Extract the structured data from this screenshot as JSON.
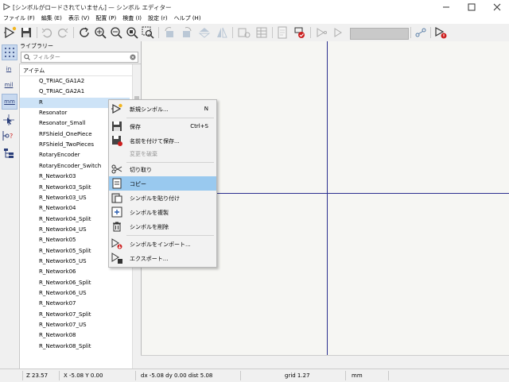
{
  "window": {
    "title": "[シンボルがロードされていません] — シンボル エディター",
    "controls": [
      "minimize",
      "maximize",
      "close"
    ]
  },
  "menubar": [
    "ファイル (F)",
    "編集 (E)",
    "表示 (V)",
    "配置 (P)",
    "検査 (I)",
    "設定 (r)",
    "ヘルプ (H)"
  ],
  "units": {
    "in": "in",
    "mil": "mil",
    "mm": "mm"
  },
  "library": {
    "header": "ライブラリー",
    "filter_placeholder": "フィルター",
    "column": "アイテム",
    "items": [
      "Q_TRIAC_GA1A2",
      "Q_TRIAC_GA2A1",
      "R",
      "Resonator",
      "Resonator_Small",
      "RFShield_OnePiece",
      "RFShield_TwoPieces",
      "RotaryEncoder",
      "RotaryEncoder_Switch",
      "R_Network03",
      "R_Network03_Split",
      "R_Network03_US",
      "R_Network04",
      "R_Network04_Split",
      "R_Network04_US",
      "R_Network05",
      "R_Network05_Split",
      "R_Network05_US",
      "R_Network06",
      "R_Network06_Split",
      "R_Network06_US",
      "R_Network07",
      "R_Network07_Split",
      "R_Network07_US",
      "R_Network08",
      "R_Network08_Split"
    ],
    "selected_item": "R"
  },
  "context_menu": {
    "new_symbol": "新規シンボル...",
    "new_symbol_shortcut": "N",
    "save": "保存",
    "save_shortcut": "Ctrl+S",
    "save_as": "名前を付けて保存...",
    "revert": "変更を破棄",
    "cut": "切り取り",
    "copy": "コピー",
    "paste": "シンボルを貼り付け",
    "duplicate": "シンボルを複製",
    "delete": "シンボルを削除",
    "import": "シンボルをインポート...",
    "export": "エクスポート..."
  },
  "statusbar": {
    "zoom": "Z 23.57",
    "xy": "X -5.08  Y 0.00",
    "delta": "dx -5.08  dy 0.00  dist 5.08",
    "grid": "grid 1.27",
    "units": "mm"
  },
  "colors": {
    "selection": "#cde3f7",
    "menu_highlight": "#99c9ef",
    "crosshair": "#2b2f8f",
    "canvas": "#f6f6f3"
  }
}
